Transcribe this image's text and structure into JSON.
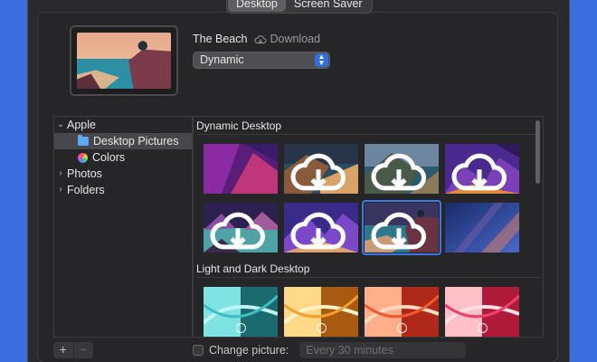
{
  "tabs": [
    {
      "label": "Desktop",
      "active": true
    },
    {
      "label": "Screen Saver",
      "active": false
    }
  ],
  "current": {
    "name": "The Beach",
    "download_label": "Download",
    "mode": "Dynamic"
  },
  "sidebar": {
    "items": [
      {
        "label": "Apple",
        "chevron": "expanded",
        "icon": "none"
      },
      {
        "label": "Desktop Pictures",
        "icon": "folder-icon",
        "selected": true
      },
      {
        "label": "Colors",
        "icon": "colors-icon"
      },
      {
        "label": "Photos",
        "chevron": "collapsed",
        "icon": "none"
      },
      {
        "label": "Folders",
        "chevron": "collapsed",
        "icon": "none"
      }
    ],
    "add_label": "+",
    "remove_label": "−"
  },
  "sections": [
    {
      "title": "Dynamic Desktop",
      "tiles": [
        {
          "theme": "purple-abstract",
          "cloud": false
        },
        {
          "theme": "coast-evening",
          "cloud": true
        },
        {
          "theme": "coast-day",
          "cloud": true
        },
        {
          "theme": "purple-hills",
          "cloud": true
        },
        {
          "theme": "lake-purple",
          "cloud": true
        },
        {
          "theme": "purple-mountains",
          "cloud": true
        },
        {
          "theme": "beach-sunset",
          "cloud": true,
          "selected": true
        },
        {
          "theme": "blue-gradient",
          "cloud": false
        }
      ]
    },
    {
      "title": "Light and Dark Desktop",
      "tiles": [
        {
          "theme": "cyan-curves"
        },
        {
          "theme": "yellow-curves"
        },
        {
          "theme": "orange-red-curves"
        },
        {
          "theme": "pink-red-curves"
        }
      ]
    }
  ],
  "footer": {
    "change_picture_label": "Change picture:",
    "interval": "Every 30 minutes"
  },
  "colors": {
    "accent": "#2f6fe0",
    "desktop_background": "#3b6fe0",
    "window": "#2a2a2c"
  }
}
